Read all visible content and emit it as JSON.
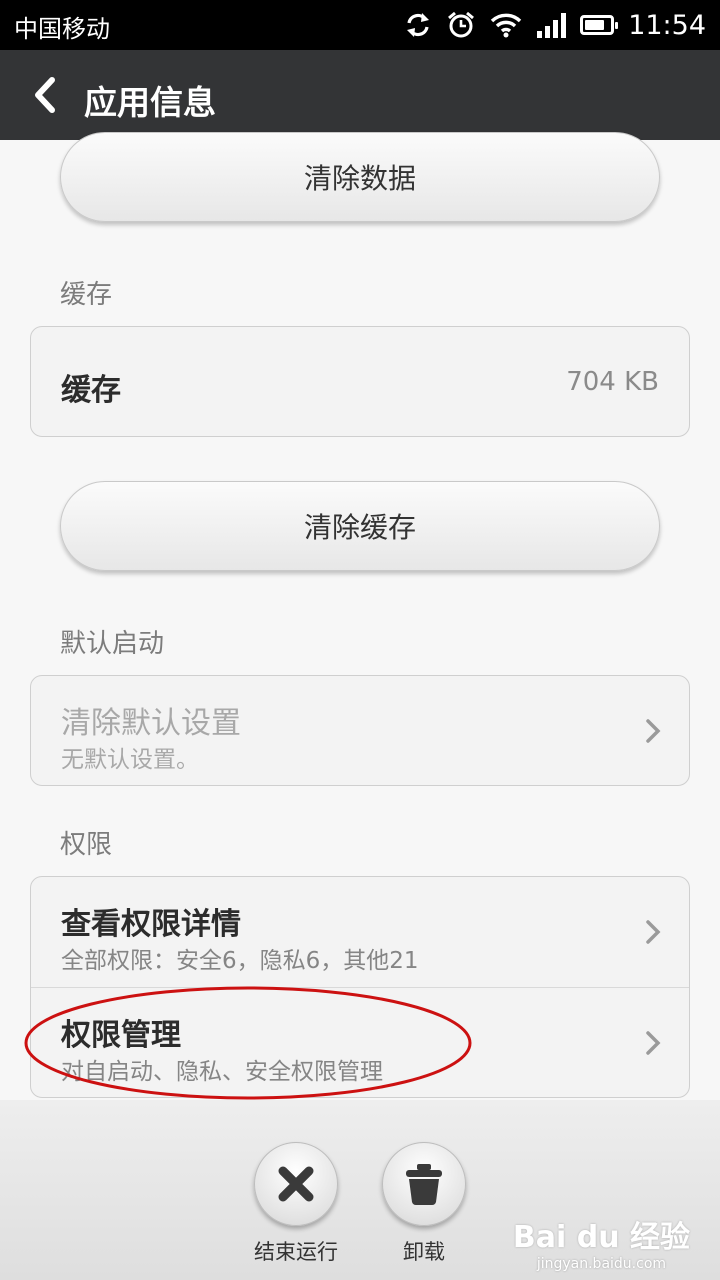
{
  "status_bar": {
    "carrier": "中国移动",
    "time": "11:54",
    "battery_level": 0.8,
    "icons": [
      "sync-icon",
      "alarm-icon",
      "wifi-icon",
      "signal-icon",
      "battery-icon"
    ]
  },
  "header": {
    "title": "应用信息"
  },
  "buttons": {
    "clear_data": "清除数据",
    "clear_cache": "清除缓存"
  },
  "cache_section": {
    "label": "缓存",
    "row_title": "缓存",
    "row_value": "704 KB"
  },
  "default_section": {
    "label": "默认启动",
    "row_title": "清除默认设置",
    "row_subtitle": "无默认设置。"
  },
  "permissions_section": {
    "label": "权限",
    "items": [
      {
        "title": "查看权限详情",
        "subtitle": "全部权限：安全6，隐私6，其他21"
      },
      {
        "title": "权限管理",
        "subtitle": "对自启动、隐私、安全权限管理"
      }
    ]
  },
  "actions": [
    {
      "label": "结束运行",
      "icon": "close-icon"
    },
    {
      "label": "卸载",
      "icon": "trash-icon"
    }
  ],
  "watermark": {
    "brand": "Bai du 经验",
    "url": "jingyan.baidu.com"
  },
  "colors": {
    "highlight": "#cc1111",
    "header_bg": "#333436"
  }
}
